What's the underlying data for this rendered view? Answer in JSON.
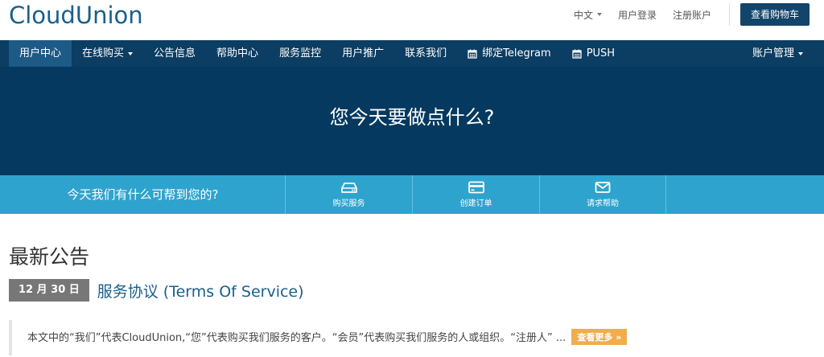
{
  "brand": {
    "logo": "CloudUnion"
  },
  "topbar": {
    "language": "中文",
    "login": "用户登录",
    "register": "注册账户",
    "cart": "查看购物车"
  },
  "nav": {
    "items": [
      {
        "label": "用户中心",
        "active": true
      },
      {
        "label": "在线购买",
        "dropdown": true
      },
      {
        "label": "公告信息"
      },
      {
        "label": "帮助中心"
      },
      {
        "label": "服务监控"
      },
      {
        "label": "用户推广"
      },
      {
        "label": "联系我们"
      },
      {
        "label": "绑定Telegram",
        "icon": "calendar-icon"
      },
      {
        "label": "PUSH",
        "icon": "calendar-icon"
      }
    ],
    "account": "账户管理"
  },
  "hero": {
    "title": "您今天要做点什么?"
  },
  "strip": {
    "prompt": "今天我们有什么可帮到您的?",
    "actions": [
      {
        "label": "购买服务",
        "icon": "server-icon"
      },
      {
        "label": "创建订单",
        "icon": "credit-card-icon"
      },
      {
        "label": "请求帮助",
        "icon": "envelope-icon"
      }
    ]
  },
  "announcements": {
    "heading": "最新公告",
    "items": [
      {
        "date": "12 月 30 日",
        "title": "服务协议 (Terms Of Service)",
        "excerpt": "本文中的“我们”代表CloudUnion,“您”代表购买我们服务的客户。“会员”代表购买我们服务的人或组织。“注册人” ...",
        "more": "查看更多 »"
      }
    ]
  },
  "colors": {
    "brand_blue": "#1a5f8a",
    "nav_bg": "#0c3d63",
    "hero_bg": "#06395f",
    "strip_bg": "#2ea3cd",
    "more_button": "#f0ad4e"
  }
}
